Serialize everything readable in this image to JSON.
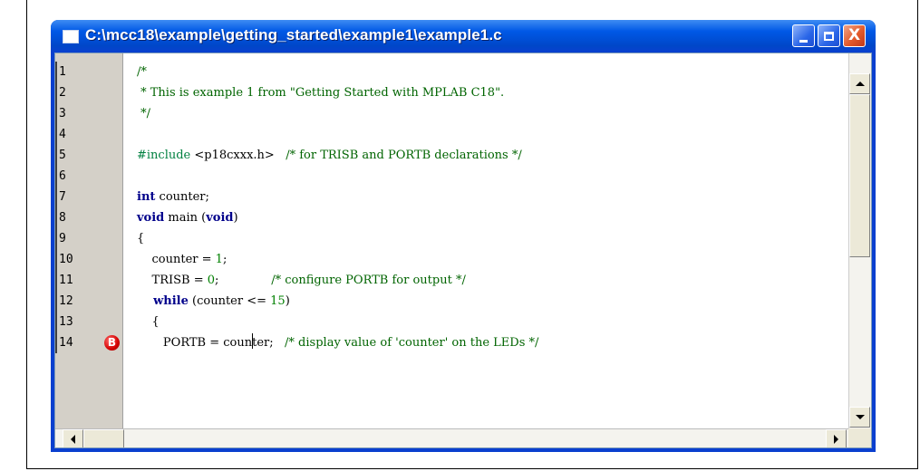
{
  "window": {
    "title": "C:\\mcc18\\example\\getting_started\\example1\\example1.c",
    "close_glyph": "X"
  },
  "editor": {
    "line_numbers": [
      "1",
      "2",
      "3",
      "4",
      "5",
      "6",
      "7",
      "8",
      "9",
      "10",
      "11",
      "12",
      "13",
      "14"
    ],
    "breakpoint": {
      "line": "14",
      "label": "B"
    },
    "lines": [
      {
        "segments": [
          {
            "cls": "cm",
            "text": "/*"
          }
        ]
      },
      {
        "segments": [
          {
            "cls": "cm",
            "text": " * This is example 1 from \"Getting Started with MPLAB C18\"."
          }
        ]
      },
      {
        "segments": [
          {
            "cls": "cm",
            "text": " */"
          }
        ]
      },
      {
        "segments": []
      },
      {
        "segments": [
          {
            "cls": "pp",
            "text": "#include"
          },
          {
            "cls": "",
            "text": " <p18cxxx.h>   "
          },
          {
            "cls": "cm",
            "text": "/* for TRISB and PORTB declarations */"
          }
        ]
      },
      {
        "segments": []
      },
      {
        "segments": [
          {
            "cls": "kw",
            "text": "int"
          },
          {
            "cls": "",
            "text": " counter;"
          }
        ]
      },
      {
        "segments": [
          {
            "cls": "kw",
            "text": "void"
          },
          {
            "cls": "",
            "text": " main ("
          },
          {
            "cls": "kw",
            "text": "void"
          },
          {
            "cls": "",
            "text": ")"
          }
        ]
      },
      {
        "segments": [
          {
            "cls": "",
            "text": "{"
          }
        ]
      },
      {
        "segments": [
          {
            "cls": "",
            "text": "    counter = "
          },
          {
            "cls": "num",
            "text": "1"
          },
          {
            "cls": "",
            "text": ";"
          }
        ]
      },
      {
        "segments": [
          {
            "cls": "",
            "text": "    TRISB = "
          },
          {
            "cls": "num",
            "text": "0"
          },
          {
            "cls": "",
            "text": ";              "
          },
          {
            "cls": "cm",
            "text": "/* configure PORTB for output */"
          }
        ]
      },
      {
        "segments": [
          {
            "cls": "kw",
            "text": "    while"
          },
          {
            "cls": "",
            "text": " (counter <= "
          },
          {
            "cls": "num",
            "text": "15"
          },
          {
            "cls": "",
            "text": ")"
          }
        ]
      },
      {
        "segments": [
          {
            "cls": "",
            "text": "    {"
          }
        ]
      },
      {
        "segments": [
          {
            "cls": "",
            "text": "       PORTB = coun"
          },
          {
            "cls": "caret",
            "text": ""
          },
          {
            "cls": "",
            "text": "ter;   "
          },
          {
            "cls": "cm",
            "text": "/* display value of 'counter' on the LEDs */"
          }
        ]
      }
    ]
  },
  "icons": {
    "app_icon": "document-icon",
    "minimize": "minimize-icon",
    "maximize": "maximize-icon",
    "close": "close-icon"
  }
}
